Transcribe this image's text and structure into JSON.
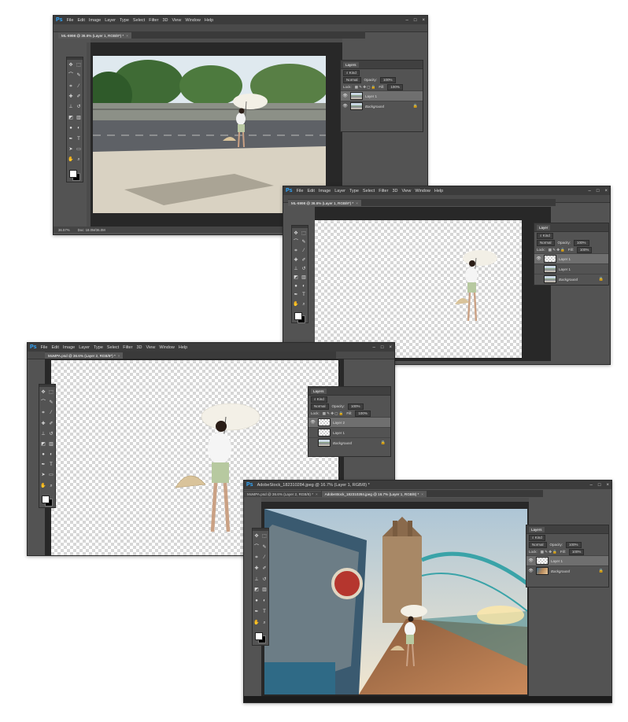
{
  "colors": {
    "ps_blue": "#31a8ff",
    "panel": "#535353",
    "menubar": "#3c3c3c",
    "workspace": "#282828"
  },
  "menu": [
    "File",
    "Edit",
    "Image",
    "Layer",
    "Type",
    "Select",
    "Filter",
    "3D",
    "View",
    "Window",
    "Help"
  ],
  "icons": {
    "tools": [
      "move-icon",
      "marquee-icon",
      "lasso-icon",
      "quick-select-icon",
      "crop-icon",
      "eyedropper-icon",
      "healing-icon",
      "brush-icon",
      "stamp-icon",
      "history-brush-icon",
      "eraser-icon",
      "gradient-icon",
      "blur-icon",
      "dodge-icon",
      "pen-icon",
      "type-icon",
      "path-select-icon",
      "shape-icon",
      "hand-icon",
      "zoom-icon"
    ]
  },
  "window1": {
    "tab": "ML-6998 @ 36.6% (Layer 1, RGB/8*) *",
    "status_zoom": "36.57%",
    "status_doc": "Doc: 18.0M/36.0M",
    "layers": {
      "title": "Layers",
      "kind": "Kind",
      "blend": "Normal",
      "opacity_label": "Opacity:",
      "opacity": "100%",
      "lock_label": "Lock:",
      "fill_label": "Fill:",
      "fill": "100%",
      "items": [
        "Layer 1",
        "Background"
      ]
    }
  },
  "window2": {
    "tab": "ML-6998 @ 36.6% (Layer 1, RGB/8*) *",
    "layers": {
      "title": "Layer",
      "kind": "Kind",
      "blend": "Normal",
      "opacity_label": "Opacity:",
      "opacity": "100%",
      "lock_label": "Lock:",
      "fill_label": "Fill:",
      "fill": "100%",
      "items": [
        "Layer 1",
        "Layer 1",
        "Background"
      ]
    }
  },
  "window3": {
    "tab": "MoMPA.psd @ 36.6% (Layer 2, RGB/8*) *",
    "layers": {
      "title": "Layers",
      "kind": "Kind",
      "blend": "Normal",
      "opacity_label": "Opacity:",
      "opacity": "100%",
      "lock_label": "Lock:",
      "fill_label": "Fill:",
      "fill": "100%",
      "items": [
        "Layer 2",
        "Layer 1",
        "Background"
      ]
    }
  },
  "window4": {
    "tabs": [
      "MoMPA.psd @ 36.6% (Layer 2, RGB/8) *",
      "AdobeStock_182310284.jpeg @ 16.7% (Layer 1, RGB/8) *"
    ],
    "title": "AdobeStock_182310284.jpeg @ 16.7% (Layer 1, RGB/8) *",
    "layers": {
      "title": "Layers",
      "kind": "Kind",
      "blend": "Normal",
      "opacity_label": "Opacity:",
      "opacity": "100%",
      "lock_label": "Lock:",
      "fill_label": "Fill:",
      "fill": "100%",
      "items": [
        "Layer 1",
        "Background"
      ]
    }
  }
}
